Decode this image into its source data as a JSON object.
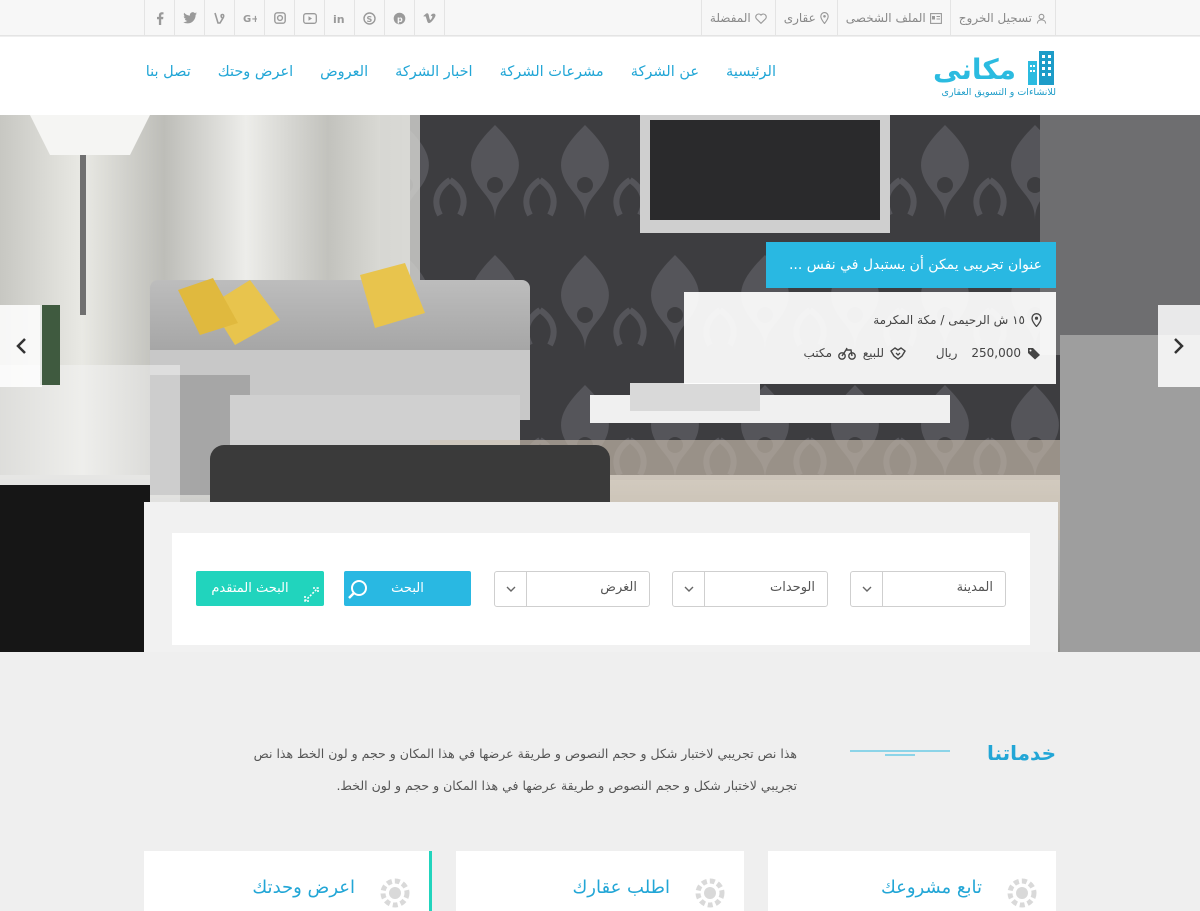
{
  "topbar": {
    "logout": "تسجيل الخروج",
    "profile": "الملف الشخصى",
    "properties": "عقارى",
    "favorites": "المفضلة",
    "social": [
      "facebook-icon",
      "twitter-icon",
      "vine-icon",
      "googleplus-icon",
      "instagram-icon",
      "youtube-icon",
      "linkedin-icon",
      "skype-icon",
      "pinterest-icon",
      "vimeo-icon"
    ]
  },
  "logo": {
    "name": "مكانى",
    "tagline": "للانشاءات و التسويق العقارى"
  },
  "nav": {
    "items": [
      "الرئيسية",
      "عن الشركة",
      "مشرعات الشركة",
      "اخبار الشركة",
      "العروض",
      "اعرض وحتك",
      "تصل بنا"
    ]
  },
  "hero": {
    "caption_title": "عنوان تجريبى يمكن أن يستبدل في نفس ...",
    "address": "١٥ ش الرحيمى / مكة المكرمة",
    "price": "250,000",
    "currency": "ريال",
    "status": "للبيع",
    "type": "مكتب"
  },
  "search": {
    "city": "المدينة",
    "units": "الوحدات",
    "purpose": "الغرض",
    "search_btn": "البحث",
    "advanced_btn": "البحث المتقدم"
  },
  "services": {
    "title": "خدماتنا",
    "text": "هذا نص تجريبي لاختبار شكل و حجم النصوص و طريقة عرضها في هذا المكان و حجم و لون الخط  هذا نص تجريبي لاختبار شكل و حجم النصوص و طريقة عرضها في هذا المكان و حجم و لون الخط."
  },
  "cards": [
    "تابع مشروعك",
    "اطلب عقارك",
    "اعرض وحدتك"
  ],
  "colors": {
    "accent": "#29b8e2",
    "teal": "#21d4bd",
    "link": "#22a6d6"
  }
}
